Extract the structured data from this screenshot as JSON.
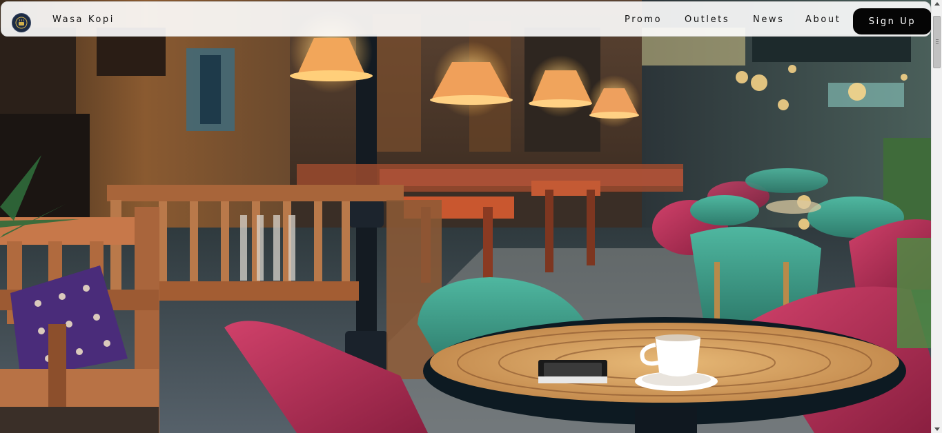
{
  "brand": {
    "name": "Wasa Kopi",
    "logo_icon": "coffee-logo-icon"
  },
  "nav": {
    "links": [
      "Promo",
      "Outlets",
      "News",
      "About"
    ],
    "signup_label": "Sign Up"
  },
  "hero": {
    "image": "outdoor-cafe-terrace-photo"
  },
  "colors": {
    "navbar_bg": "#ffffff",
    "signup_bg": "#050505",
    "signup_text": "#ffffff",
    "text": "#111111"
  }
}
